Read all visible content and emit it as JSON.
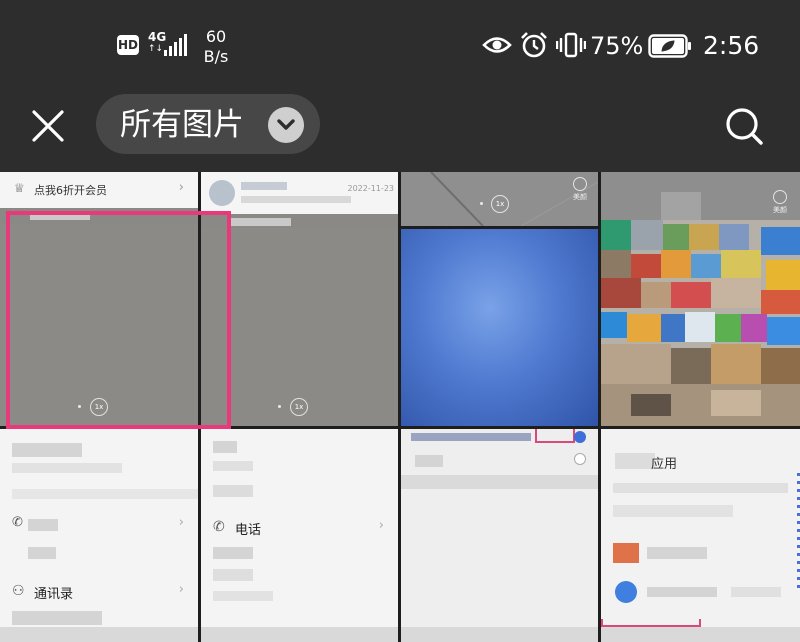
{
  "status_bar": {
    "hd": "HD",
    "network_type": "4G",
    "network_arrows": "↑↓",
    "net_speed_value": "60",
    "net_speed_unit": "B/s",
    "battery_percent": "75%",
    "time": "2:56"
  },
  "toolbar": {
    "album_title": "所有图片"
  },
  "photos": {
    "t1": {
      "header_text": "点我6折开会员",
      "cam_badge": "1x"
    },
    "t2": {
      "msg_date": "2022-11-23",
      "cam_badge": "1x"
    },
    "t3": {
      "cam_badge": "1x",
      "beauty_label": "美颜"
    },
    "t4": {
      "beauty_label": "美颜"
    },
    "t6": {
      "row_label": "通讯录"
    },
    "t7": {
      "row_label": "电话"
    },
    "t9": {
      "row_label": "应用"
    }
  },
  "colors": {
    "background": "#2d2d2d",
    "selector_bg": "#474747",
    "highlight": "#e8397a",
    "blue_photo": "#4a6fc7"
  }
}
